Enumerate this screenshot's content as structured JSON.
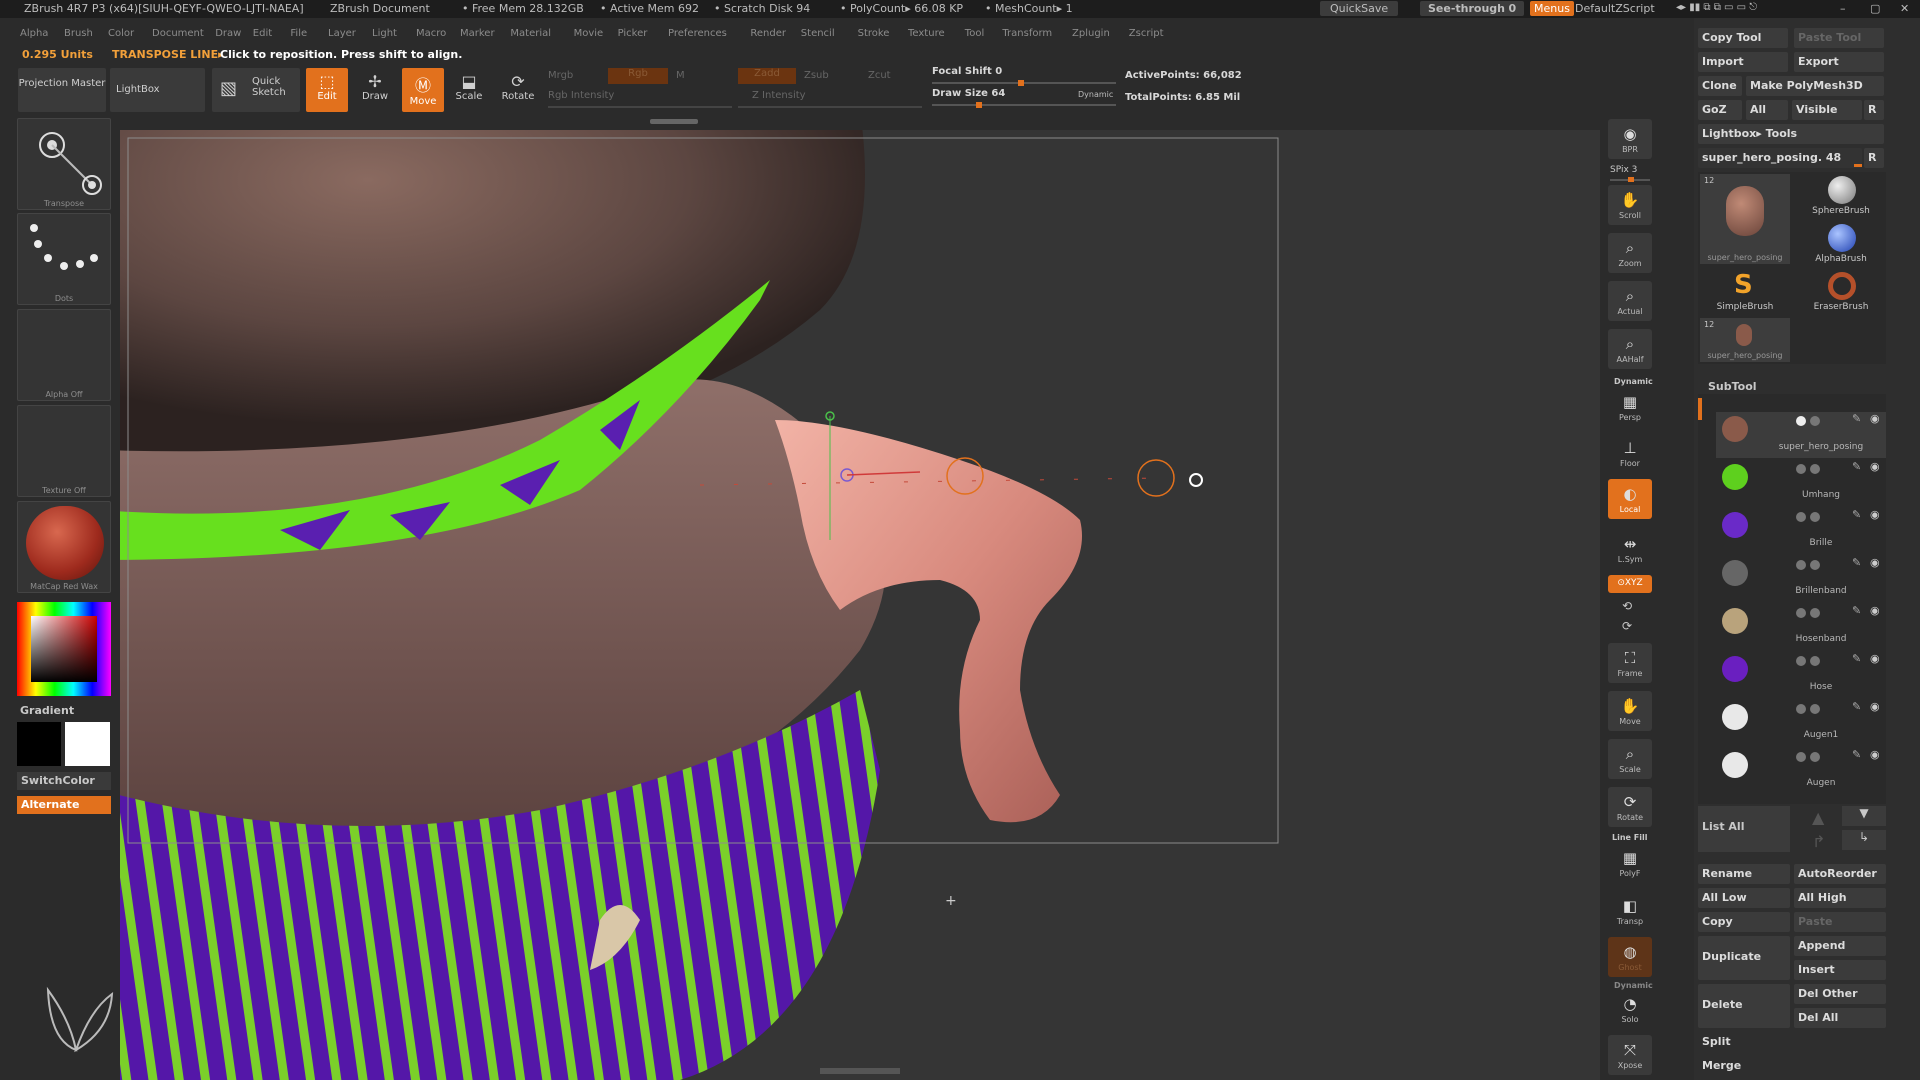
{
  "title_bar": {
    "app_title": "ZBrush 4R7 P3 (x64)[SIUH-QEYF-QWEO-LJTI-NAEA]",
    "document": "ZBrush Document",
    "free_mem": "• Free Mem 28.132GB",
    "active_mem": "• Active Mem 692",
    "scratch_disk": "• Scratch Disk 94",
    "polycount": "• PolyCount▸ 66.08 KP",
    "meshcount": "• MeshCount▸ 1",
    "quicksave": "QuickSave",
    "see_through": "See-through",
    "see_through_value": "0",
    "menus": "Menus",
    "default_script": "DefaultZScript"
  },
  "menu_bar": [
    "Alpha",
    "Brush",
    "Color",
    "Document",
    "Draw",
    "Edit",
    "File",
    "Layer",
    "Light",
    "Macro",
    "Marker",
    "Material",
    "Movie",
    "Picker",
    "Preferences",
    "Render",
    "Stencil",
    "Stroke",
    "Texture",
    "Tool",
    "Transform",
    "Zplugin",
    "Zscript"
  ],
  "hint_bar": {
    "units": "0.295 Units",
    "mode": "TRANSPOSE LINE▸",
    "message": "Click to reposition. Press shift to align."
  },
  "toolbar": {
    "projection_master": "Projection Master",
    "lightbox": "LightBox",
    "quick_sketch": "Quick Sketch",
    "edit": "Edit",
    "draw": "Draw",
    "move": "Move",
    "scale": "Scale",
    "rotate": "Rotate",
    "mrgb": "Mrgb",
    "rgb": "Rgb",
    "m": "M",
    "rgb_intensity": "Rgb Intensity",
    "zadd": "Zadd",
    "zsub": "Zsub",
    "zcut": "Zcut",
    "z_intensity": "Z Intensity",
    "focal_shift": "Focal Shift 0",
    "draw_size": "Draw Size 64",
    "dynamic": "Dynamic",
    "active_points": "ActivePoints: 66,082",
    "total_points": "TotalPoints: 6.85 Mil"
  },
  "left_shelf": {
    "transpose": "Transpose",
    "dots": "Dots",
    "alpha_off": "Alpha Off",
    "texture_off": "Texture Off",
    "material": "MatCap Red Wax",
    "gradient": "Gradient",
    "switch_color": "SwitchColor",
    "alternate": "Alternate"
  },
  "right_shelf": {
    "bpr": "BPR",
    "spix": "SPix 3",
    "scroll": "Scroll",
    "zoom": "Zoom",
    "actual": "Actual",
    "aahalf": "AAHalf",
    "dynamic": "Dynamic",
    "persp": "Persp",
    "floor": "Floor",
    "local": "Local",
    "lsym": "L.Sym",
    "xyz": "⊙XYZ",
    "frame": "Frame",
    "move": "Move",
    "scale": "Scale",
    "rotate": "Rotate",
    "line_fill": "Line Fill",
    "polyf": "PolyF",
    "transp": "Transp",
    "ghost": "Ghost",
    "dynamic2": "Dynamic",
    "solo": "Solo",
    "xpose": "Xpose"
  },
  "tool_panel": {
    "copy_tool": "Copy Tool",
    "paste_tool": "Paste Tool",
    "import": "Import",
    "export": "Export",
    "clone": "Clone",
    "make_polymesh": "Make PolyMesh3D",
    "goz": "GoZ",
    "all": "All",
    "visible": "Visible",
    "r": "R",
    "lightbox_tools": "Lightbox▸ Tools",
    "current_tool": "super_hero_posing. 48",
    "thumbs": [
      {
        "label": "super_hero_posing",
        "count": "12"
      },
      {
        "label": "SphereBrush"
      },
      {
        "label": "AlphaBrush"
      },
      {
        "label": "SimpleBrush"
      },
      {
        "label": "EraserBrush"
      },
      {
        "label": "super_hero_posing",
        "count": "12"
      }
    ],
    "subtool_header": "SubTool",
    "subtools": [
      "super_hero_posing",
      "Umhang",
      "Brille",
      "Brillenband",
      "Hosenband",
      "Hose",
      "Augen1",
      "Augen"
    ],
    "list_all": "List All",
    "rename": "Rename",
    "autoreorder": "AutoReorder",
    "all_low": "All Low",
    "all_high": "All High",
    "copy": "Copy",
    "paste": "Paste",
    "duplicate": "Duplicate",
    "append": "Append",
    "insert": "Insert",
    "delete": "Delete",
    "del_other": "Del Other",
    "del_all": "Del All",
    "split": "Split",
    "merge": "Merge"
  },
  "colors": {
    "accent": "#e2711d",
    "panel": "#2e2e2e",
    "canvas": "#353535",
    "skin": "#d9958a",
    "green": "#6fe21a",
    "purple": "#5a1fb0"
  }
}
